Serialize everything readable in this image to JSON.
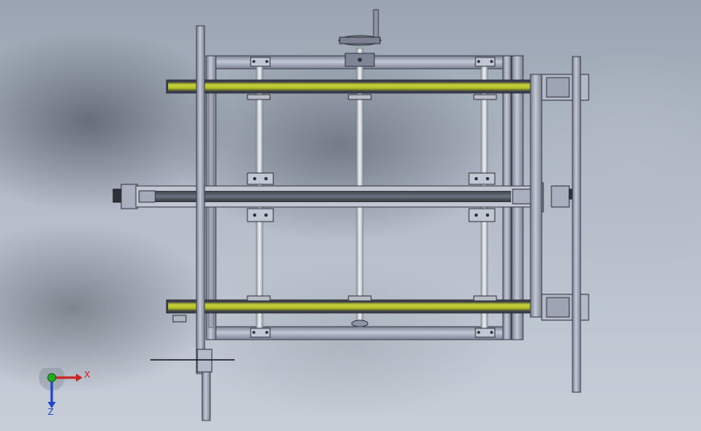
{
  "viewport": {
    "background_top": "#9aa4b2",
    "background_bottom": "#c7ced8"
  },
  "model": {
    "frame_color": "#9aa0b4",
    "rail_color": "#b9c32d",
    "shaft_color": "#e2e6ea"
  },
  "triad": {
    "x_label": "X",
    "z_label": "Z",
    "x_color": "#cc2222",
    "y_color": "#22aa22",
    "z_color": "#2244cc"
  }
}
